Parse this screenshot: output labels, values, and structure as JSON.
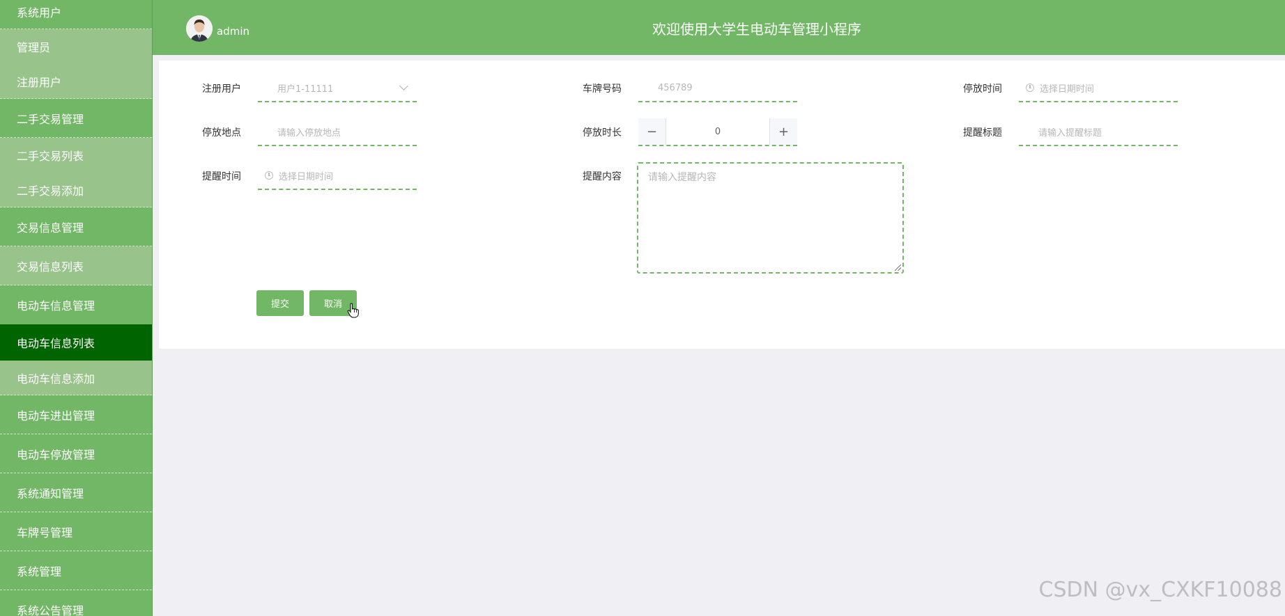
{
  "sidebar": {
    "items": [
      {
        "label": "系统用户"
      },
      {
        "label": "管理员"
      },
      {
        "label": "注册用户"
      },
      {
        "label": "二手交易管理"
      },
      {
        "label": "二手交易列表"
      },
      {
        "label": "二手交易添加"
      },
      {
        "label": "交易信息管理"
      },
      {
        "label": "交易信息列表"
      },
      {
        "label": "电动车信息管理"
      },
      {
        "label": "电动车信息列表"
      },
      {
        "label": "电动车信息添加"
      },
      {
        "label": "电动车进出管理"
      },
      {
        "label": "电动车停放管理"
      },
      {
        "label": "系统通知管理"
      },
      {
        "label": "车牌号管理"
      },
      {
        "label": "系统管理"
      },
      {
        "label": "系统公告管理"
      }
    ],
    "active_item": "电动车信息列表"
  },
  "header": {
    "username": "admin",
    "title": "欢迎使用大学生电动车管理小程序"
  },
  "form": {
    "registered_user": {
      "label": "注册用户",
      "placeholder": "用户1-11111"
    },
    "plate_number": {
      "label": "车牌号码",
      "placeholder": "456789"
    },
    "park_time": {
      "label": "停放时间",
      "placeholder": "选择日期时间"
    },
    "park_location": {
      "label": "停放地点",
      "placeholder": "请输入停放地点"
    },
    "park_duration": {
      "label": "停放时长",
      "value": "0",
      "minus": "−",
      "plus": "+"
    },
    "reminder_title": {
      "label": "提醒标题",
      "placeholder": "请输入提醒标题"
    },
    "reminder_time": {
      "label": "提醒时间",
      "placeholder": "选择日期时间"
    },
    "reminder_content": {
      "label": "提醒内容",
      "placeholder": "请输入提醒内容"
    },
    "submit_label": "提交",
    "cancel_label": "取消"
  },
  "watermark": "CSDN @vx_CXKF10088",
  "colors": {
    "sidebar": "#72b766",
    "sidebar_sub": "#98c48c",
    "active": "#006400",
    "accent": "#72b766",
    "page_bg": "#efeff4"
  }
}
